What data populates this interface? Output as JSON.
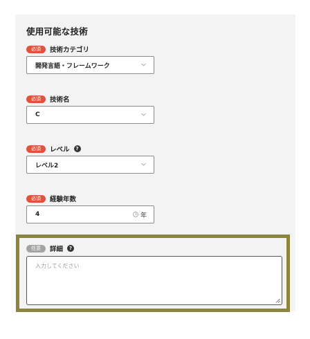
{
  "section": {
    "title": "使用可能な技術"
  },
  "badges": {
    "required": "必須",
    "optional": "任意"
  },
  "fields": {
    "category": {
      "label": "技術カテゴリ",
      "value": "開発言語・フレームワーク"
    },
    "name": {
      "label": "技術名",
      "value": "C"
    },
    "level": {
      "label": "レベル",
      "value": "レベル2"
    },
    "years": {
      "label": "経験年数",
      "value": "4",
      "unit": "年"
    },
    "detail": {
      "label": "詳細",
      "placeholder": "入力してください"
    }
  },
  "icons": {
    "help": "?",
    "chevron": "chevron-down-icon",
    "clock": "clock-icon"
  },
  "colors": {
    "required_badge": "#e0533a",
    "optional_badge": "#a3a3a3",
    "highlight_border": "#8b8540"
  }
}
